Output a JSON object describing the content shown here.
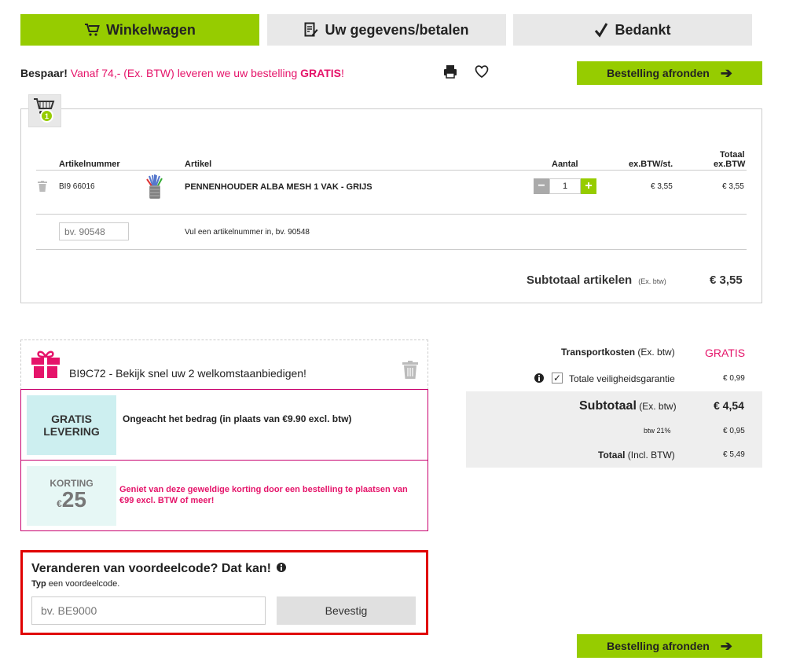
{
  "steps": [
    {
      "label": "Winkelwagen",
      "icon": "cart-icon"
    },
    {
      "label": "Uw gegevens/betalen",
      "icon": "edit-icon"
    },
    {
      "label": "Bedankt",
      "icon": "check-icon"
    }
  ],
  "promo": {
    "prefix": "Bespaar!",
    "text": " Vanaf 74,- (Ex. BTW) leveren we uw bestelling ",
    "highlight": "GRATIS",
    "suffix": "!"
  },
  "finish_button": "Bestelling afronden",
  "cart": {
    "count": "1",
    "headers": {
      "artnr": "Artikelnummer",
      "artikel": "Artikel",
      "aantal": "Aantal",
      "price": "ex.BTW/st.",
      "total_1": "Totaal",
      "total_2": "ex.BTW"
    },
    "item": {
      "artnr": "BI9 66016",
      "name": "PENNENHOUDER ALBA MESH 1 VAK - GRIJS",
      "qty": "1",
      "price": "€ 3,55",
      "total": "€ 3,55"
    },
    "input_placeholder": "bv. 90548",
    "input_hint": "Vul een artikelnummer in, bv. 90548",
    "subtotal_label": "Subtotaal artikelen",
    "subtotal_note": "(Ex. btw)",
    "subtotal_value": "€ 3,55"
  },
  "offers": {
    "header": "BI9C72 - Bekijk snel uw 2 welkomstaanbiedigen!",
    "free_delivery_img": [
      "GRATIS",
      "LEVERING"
    ],
    "free_delivery_text": "Ongeacht het bedrag (in plaats van €9.90 excl. btw)",
    "discount_img_label": "KORTING",
    "discount_img_currency": "€",
    "discount_img_amount": "25",
    "discount_text": "Geniet van deze geweldige korting door een bestelling te plaatsen van €99 excl. BTW of meer!"
  },
  "code": {
    "title": "Veranderen van voordeelcode? Dat kan!",
    "sub_bold": "Typ",
    "sub_rest": " een voordeelcode.",
    "placeholder": "bv. BE9000",
    "button": "Bevestig"
  },
  "totals": {
    "transport_label": "Transportkosten",
    "transport_note": "(Ex. btw)",
    "transport_value": "GRATIS",
    "guarantee_label": "Totale veiligheidsgarantie",
    "guarantee_value": "€ 0,99",
    "subtotal_label": "Subtotaal",
    "subtotal_note": "(Ex. btw)",
    "subtotal_value": "€ 4,54",
    "vat_label": "btw 21%",
    "vat_value": "€ 0,95",
    "total_label": "Totaal",
    "total_note": "(Incl. BTW)",
    "total_value": "€ 5,49"
  },
  "colors": {
    "accent": "#96cc00",
    "pink": "#e5146a",
    "border_red": "#e00000"
  }
}
